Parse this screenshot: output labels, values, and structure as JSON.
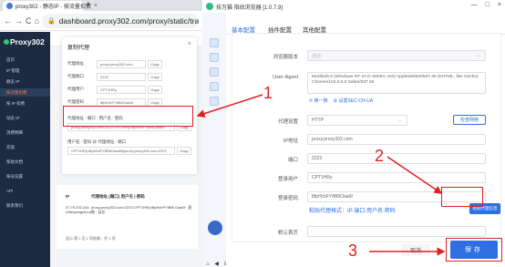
{
  "browser": {
    "tab_title": "proxy302 - 静态IP - 按流量扣费",
    "tab_close": "×",
    "new_tab": "+",
    "nav": {
      "back": "←",
      "forward": "→",
      "reload": "C",
      "home": "⌂"
    },
    "url": "dashboard.proxy302.com/proxy/static/tra..."
  },
  "app": {
    "logo": "Proxy302",
    "sidebar": [
      {
        "label": "首页"
      },
      {
        "label": "IP 管理"
      },
      {
        "label": "静态 IP"
      },
      {
        "label": "按流量扣费"
      },
      {
        "label": "按 IP 扣费"
      },
      {
        "label": "动态 IP"
      },
      {
        "label": "消费明细"
      },
      {
        "label": "充值"
      },
      {
        "label": "帮助文档"
      },
      {
        "label": "账号设置"
      },
      {
        "label": "API"
      },
      {
        "label": "联系我们"
      }
    ]
  },
  "dialog": {
    "title": "复制代理",
    "close": "×",
    "rows": [
      {
        "label": "代理地址",
        "value": "proxy.proxy302.com",
        "copy": "Copy"
      },
      {
        "label": "代理端口",
        "value": "2222",
        "copy": "Copy"
      },
      {
        "label": "代理用户",
        "value": "CPT1HRy",
        "copy": "Copy"
      },
      {
        "label": "代理密码",
        "value": "8fpHcbFY8B6Oaa6f",
        "copy": "Copy"
      }
    ],
    "format1": {
      "label": "代理地址 : 端口 : 用户名 : 密码",
      "value": "proxy.proxy302.com:2222:CPT1HRy:8fpHcbFY8B6Oaa6f",
      "copy": "Copy"
    },
    "format2": {
      "label": "用户名 : 密码 @ 代理地址 : 端口",
      "value": "CPT1HRy:8fpHcbFY8B6Oaa6f@proxy.proxy302.com:2222",
      "copy": "Copy"
    }
  },
  "table": {
    "col_ip": "IP",
    "col_proxy": "代理地址 (端口) 用户名 | 密码",
    "ip": "47.76.232.244 (Xiaoyangshou)",
    "proxy": "proxy.proxy302.com:2222:CPT1HRy:8fpHcbFY8B6 Oaa6f · 复制 · 延长",
    "pager": "显示 第 1 至 1 项结果，共 1 项"
  },
  "rwin": {
    "title": "技万猫 指纹浏览器 [1.0.7.9]",
    "buttons": [
      "—",
      "□",
      "×"
    ],
    "tabs": [
      {
        "label": "基本配置"
      },
      {
        "label": "插件配置"
      },
      {
        "label": "其他配置"
      }
    ],
    "form": {
      "browser_version_label": "浏览器版本",
      "browser_version_value": "自动",
      "ua_label": "User-Agent",
      "ua_value": "Mozilla/5.0 (Windows NT 10.0; Win64; x64) AppleWebKit/537.36 (KHTML, like Gecko) Chrome/104.0.0.0 Safari/537.36",
      "ua_change": "换一换",
      "ua_sec": "设置SEC-CH-UA",
      "proxy_label": "代理设置",
      "proxy_value": "HTTP",
      "check_label": "检查网络",
      "ip_label": "IP地址",
      "ip_value": "proxy.proxy302.com",
      "port_label": "端口",
      "port_value": "2222",
      "user_label": "登录用户",
      "user_value": "CPT1HRy",
      "pass_label": "登录密码",
      "pass_value": "8fpHcbFY8B6Oaa6f",
      "paste_hint": "粘贴代理格式：IP:端口:用户名:密码",
      "paste_button": "粘贴代理信息",
      "homepage_label": "默认首页"
    },
    "cancel": "取消",
    "save": "保存"
  },
  "annotations": [
    "1",
    "2",
    "3"
  ]
}
